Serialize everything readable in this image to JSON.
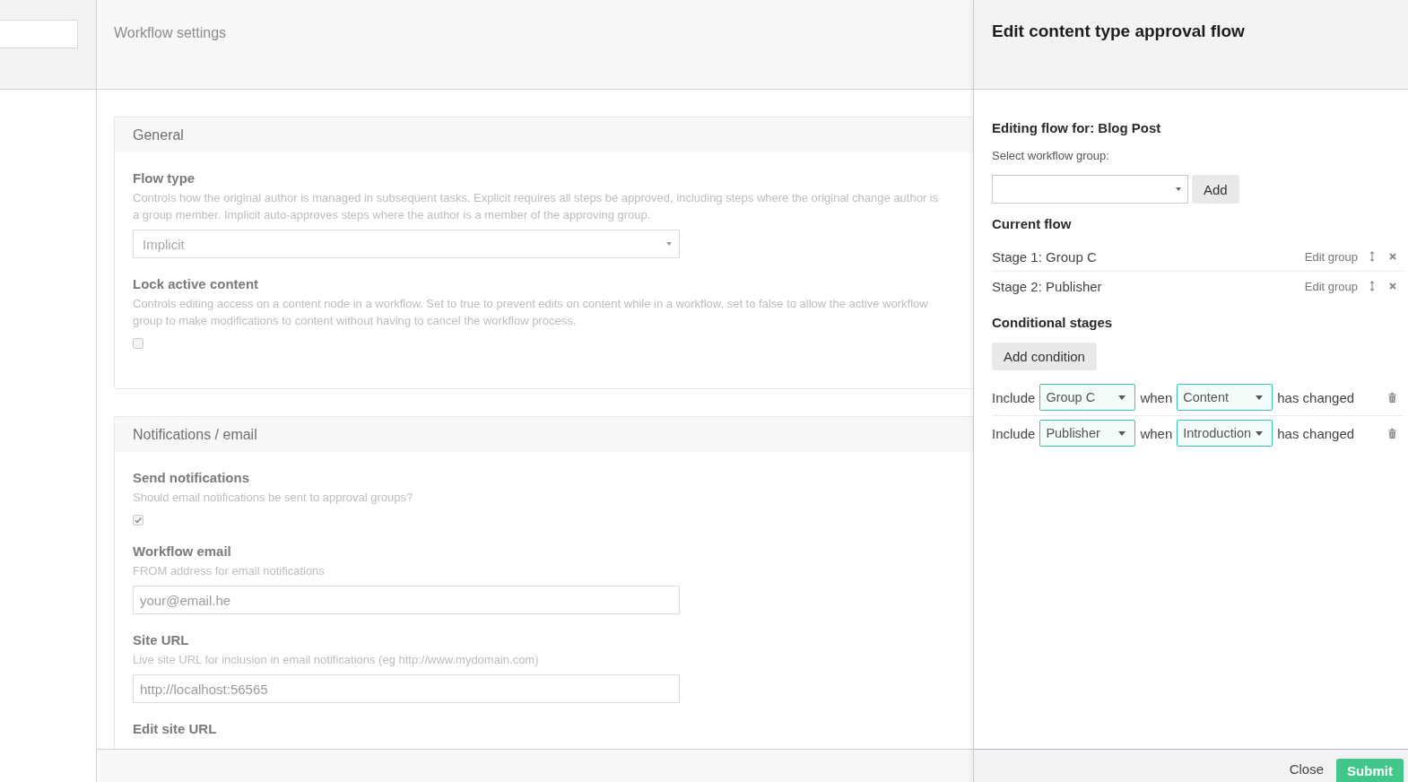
{
  "main": {
    "title": "Workflow settings",
    "sections": [
      {
        "title": "General",
        "settings": [
          {
            "kind": "select",
            "label": "Flow type",
            "description": "Controls how the original author is managed in subsequent tasks. Explicit requires all steps be approved, including steps where the original change author is a group member. Implicit auto-approves steps where the author is a member of the approving group.",
            "value": "Implicit"
          },
          {
            "kind": "checkbox",
            "label": "Lock active content",
            "description": "Controls editing access on a content node in a workflow. Set to true to prevent edits on content while in a workflow, set to false to allow the active workflow group to make modifications to content without having to cancel the workflow process.",
            "checked": false
          }
        ]
      },
      {
        "title": "Notifications / email",
        "settings": [
          {
            "kind": "checkbox",
            "label": "Send notifications",
            "description": "Should email notifications be sent to approval groups?",
            "checked": true
          },
          {
            "kind": "text",
            "label": "Workflow email",
            "description": "FROM address for email notifications",
            "value": "your@email.he"
          },
          {
            "kind": "text",
            "label": "Site URL",
            "description": "Live site URL for inclusion in email notifications (eg http://www.mydomain.com)",
            "value": "http://localhost:56565"
          },
          {
            "kind": "text",
            "label": "Edit site URL"
          }
        ]
      }
    ]
  },
  "panel": {
    "title": "Edit content type approval flow",
    "editing_label": "Editing flow for: Blog Post",
    "group_label": "Select workflow group:",
    "add_button": "Add",
    "current_flow": {
      "title": "Current flow",
      "stages": [
        {
          "name": "Stage 1: Group C",
          "edit_label": "Edit group"
        },
        {
          "name": "Stage 2: Publisher",
          "edit_label": "Edit group"
        }
      ]
    },
    "conditional": {
      "title": "Conditional stages",
      "add_button": "Add condition",
      "conditions": [
        {
          "include_label": "Include",
          "group": "Group C",
          "when_label": "when",
          "property": "Content",
          "suffix": "has changed"
        },
        {
          "include_label": "Include",
          "group": "Publisher",
          "when_label": "when",
          "property": "Introduction",
          "suffix": "has changed"
        }
      ]
    },
    "footer": {
      "close": "Close",
      "submit": "Submit"
    }
  }
}
